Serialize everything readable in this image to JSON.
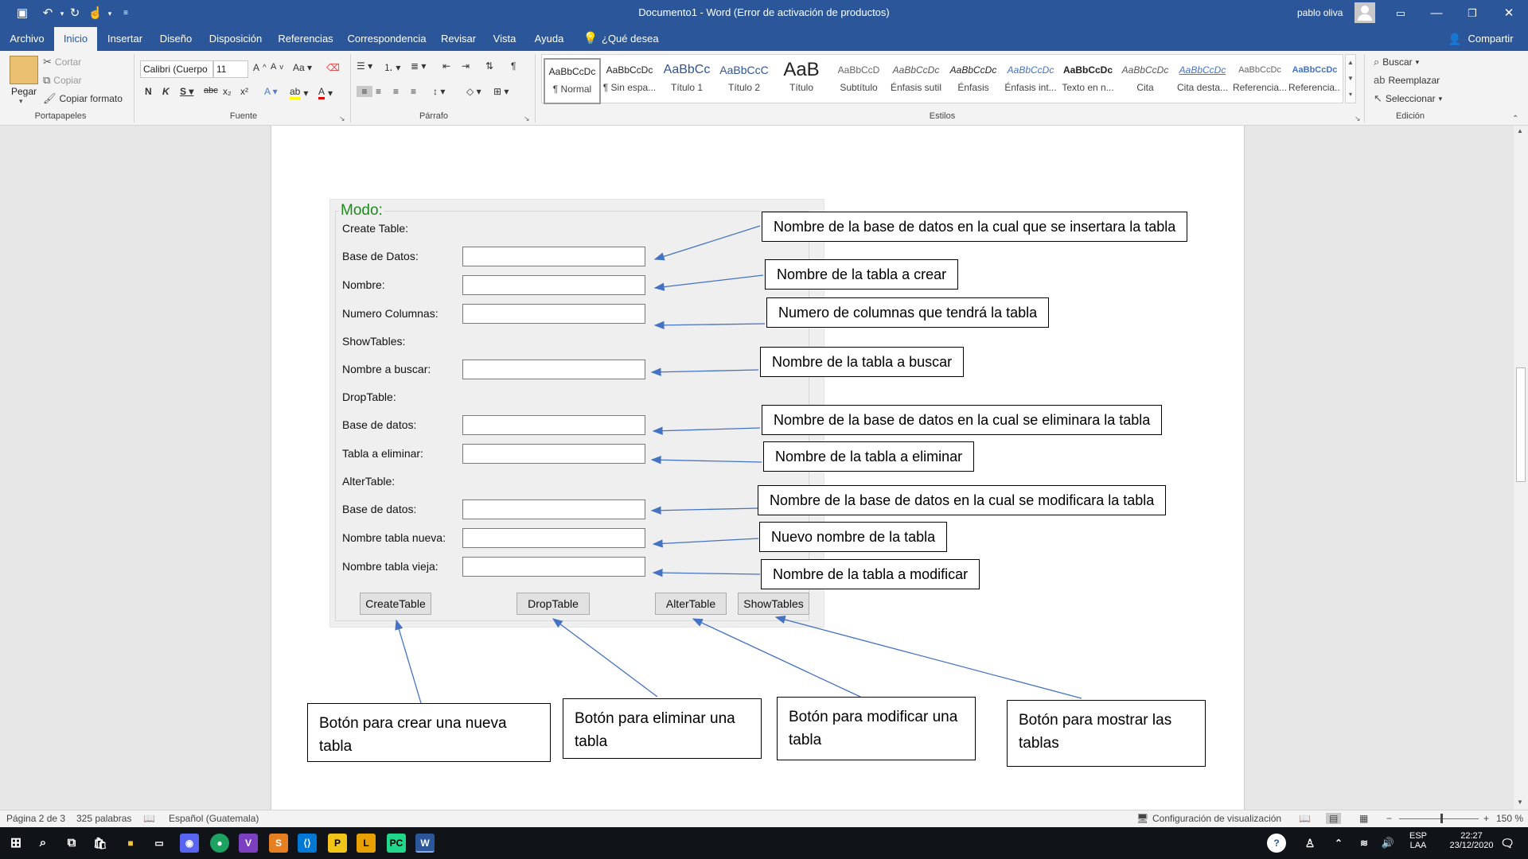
{
  "window": {
    "title": "Documento1  -  Word (Error de activación de productos)",
    "user": "pablo oliva"
  },
  "tabs": [
    "Archivo",
    "Inicio",
    "Insertar",
    "Diseño",
    "Disposición",
    "Referencias",
    "Correspondencia",
    "Revisar",
    "Vista",
    "Ayuda"
  ],
  "tell_me": "¿Qué desea hacer?",
  "share": "Compartir",
  "clipboard": {
    "paste": "Pegar",
    "cut": "Cortar",
    "copy": "Copiar",
    "format_painter": "Copiar formato",
    "label": "Portapapeles"
  },
  "font": {
    "name": "Calibri (Cuerpo",
    "size": "11",
    "label": "Fuente"
  },
  "paragraph": {
    "label": "Párrafo"
  },
  "styles": {
    "label": "Estilos",
    "items": [
      {
        "sample": "AaBbCcDc",
        "name": "¶ Normal"
      },
      {
        "sample": "AaBbCcDc",
        "name": "¶ Sin espa..."
      },
      {
        "sample": "AaBbCc",
        "name": "Título 1"
      },
      {
        "sample": "AaBbCcC",
        "name": "Título 2"
      },
      {
        "sample": "AaB",
        "name": "Título"
      },
      {
        "sample": "AaBbCcD",
        "name": "Subtítulo"
      },
      {
        "sample": "AaBbCcDc",
        "name": "Énfasis sutil"
      },
      {
        "sample": "AaBbCcDc",
        "name": "Énfasis"
      },
      {
        "sample": "AaBbCcDc",
        "name": "Énfasis int..."
      },
      {
        "sample": "AaBbCcDc",
        "name": "Texto en n..."
      },
      {
        "sample": "AaBbCcDc",
        "name": "Cita"
      },
      {
        "sample": "AaBbCcDc",
        "name": "Cita desta..."
      },
      {
        "sample": "AaBbCcDc",
        "name": "Referencia..."
      },
      {
        "sample": "AaBbCcDc",
        "name": "Referencia..."
      }
    ]
  },
  "editing": {
    "find": "Buscar",
    "replace": "Reemplazar",
    "select": "Seleccionar",
    "label": "Edición"
  },
  "form": {
    "legend": "Modo:",
    "create_table": "Create Table:",
    "create_db": "Base de Datos:",
    "create_name": "Nombre:",
    "create_cols": "Numero Columnas:",
    "show_tables": "ShowTables:",
    "show_name": "Nombre a buscar:",
    "drop_table": "DropTable:",
    "drop_db": "Base de datos:",
    "drop_name": "Tabla a eliminar:",
    "alter_table": "AlterTable:",
    "alter_db": "Base de datos:",
    "alter_new": "Nombre tabla nueva:",
    "alter_old": "Nombre tabla vieja:",
    "btn_create": "CreateTable",
    "btn_drop": "DropTable",
    "btn_alter": "AlterTable",
    "btn_show": "ShowTables"
  },
  "callouts": {
    "c1": "Nombre de la base de datos en la cual que se insertara la tabla",
    "c2": "Nombre de la tabla a crear",
    "c3": "Numero de columnas que tendrá la tabla",
    "c4": "Nombre de la tabla a buscar",
    "c5": "Nombre de la base de datos en la cual se eliminara la tabla",
    "c6": "Nombre de la tabla a eliminar",
    "c7": "Nombre de la base de datos en la cual se modificara la tabla",
    "c8": "Nuevo nombre de la tabla",
    "c9": "Nombre de la tabla a modificar",
    "b1": "Botón para crear una nueva tabla",
    "b2": "Botón para eliminar una tabla",
    "b3": "Botón para modificar una tabla",
    "b4": "Botón para mostrar las tablas"
  },
  "status": {
    "page": "Página 2 de 3",
    "words": "325 palabras",
    "language": "Español (Guatemala)",
    "display_settings": "Configuración de visualización",
    "zoom": "150 %"
  },
  "taskbar": {
    "lang1": "ESP",
    "lang2": "LAA",
    "time": "22:27",
    "date": "23/12/2020"
  },
  "colors": {
    "word_blue": "#2b579a",
    "accent": "#2b579a"
  }
}
